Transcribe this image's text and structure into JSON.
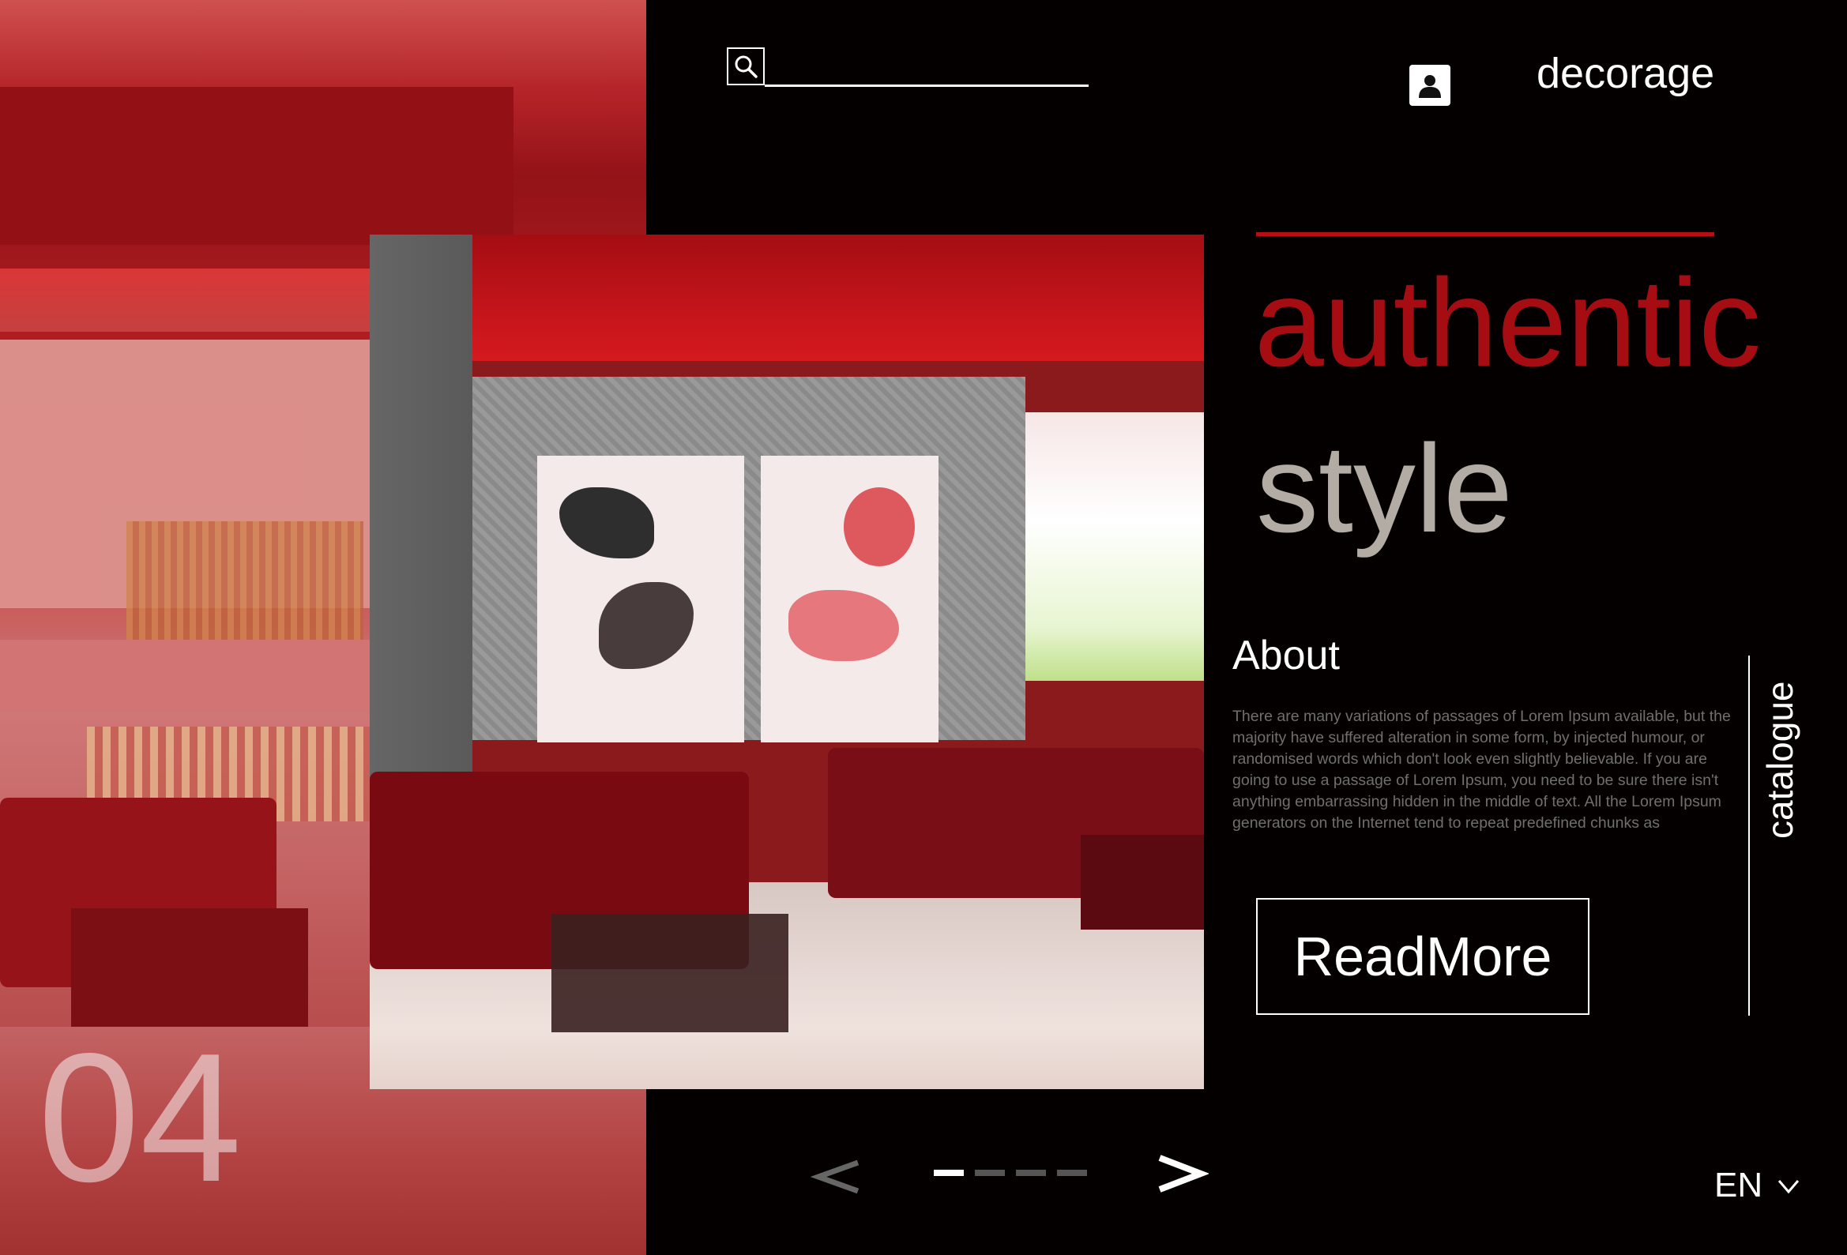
{
  "header": {
    "search": {
      "placeholder": ""
    },
    "brand": "decorage"
  },
  "hero": {
    "title_line1": "authentic",
    "title_line2": "style"
  },
  "about": {
    "heading": "About",
    "body": "There are many variations of passages of Lorem Ipsum available, but the majority have suffered alteration in some form, by injected humour, or randomised words which don't look even slightly believable. If you are going to use a passage of Lorem Ipsum, you need to be sure there isn't anything embarrassing hidden in the middle of text. All the Lorem Ipsum generators on the Internet tend to repeat predefined chunks as"
  },
  "cta": {
    "read_more": "ReadMore"
  },
  "side_nav": {
    "catalogue": "catalogue"
  },
  "slider": {
    "current_slide": "04",
    "total_dots": 4,
    "active_dot": 1,
    "prev_icon": "chevron-left-icon",
    "next_icon": "chevron-right-icon"
  },
  "language": {
    "current": "EN",
    "dropdown_icon": "chevron-down-icon"
  },
  "colors": {
    "background": "#050000",
    "accent_red": "#a60d12",
    "title_gray": "#b3aca4",
    "body_gray": "#6f6f6f",
    "text_white": "#ffffff"
  }
}
